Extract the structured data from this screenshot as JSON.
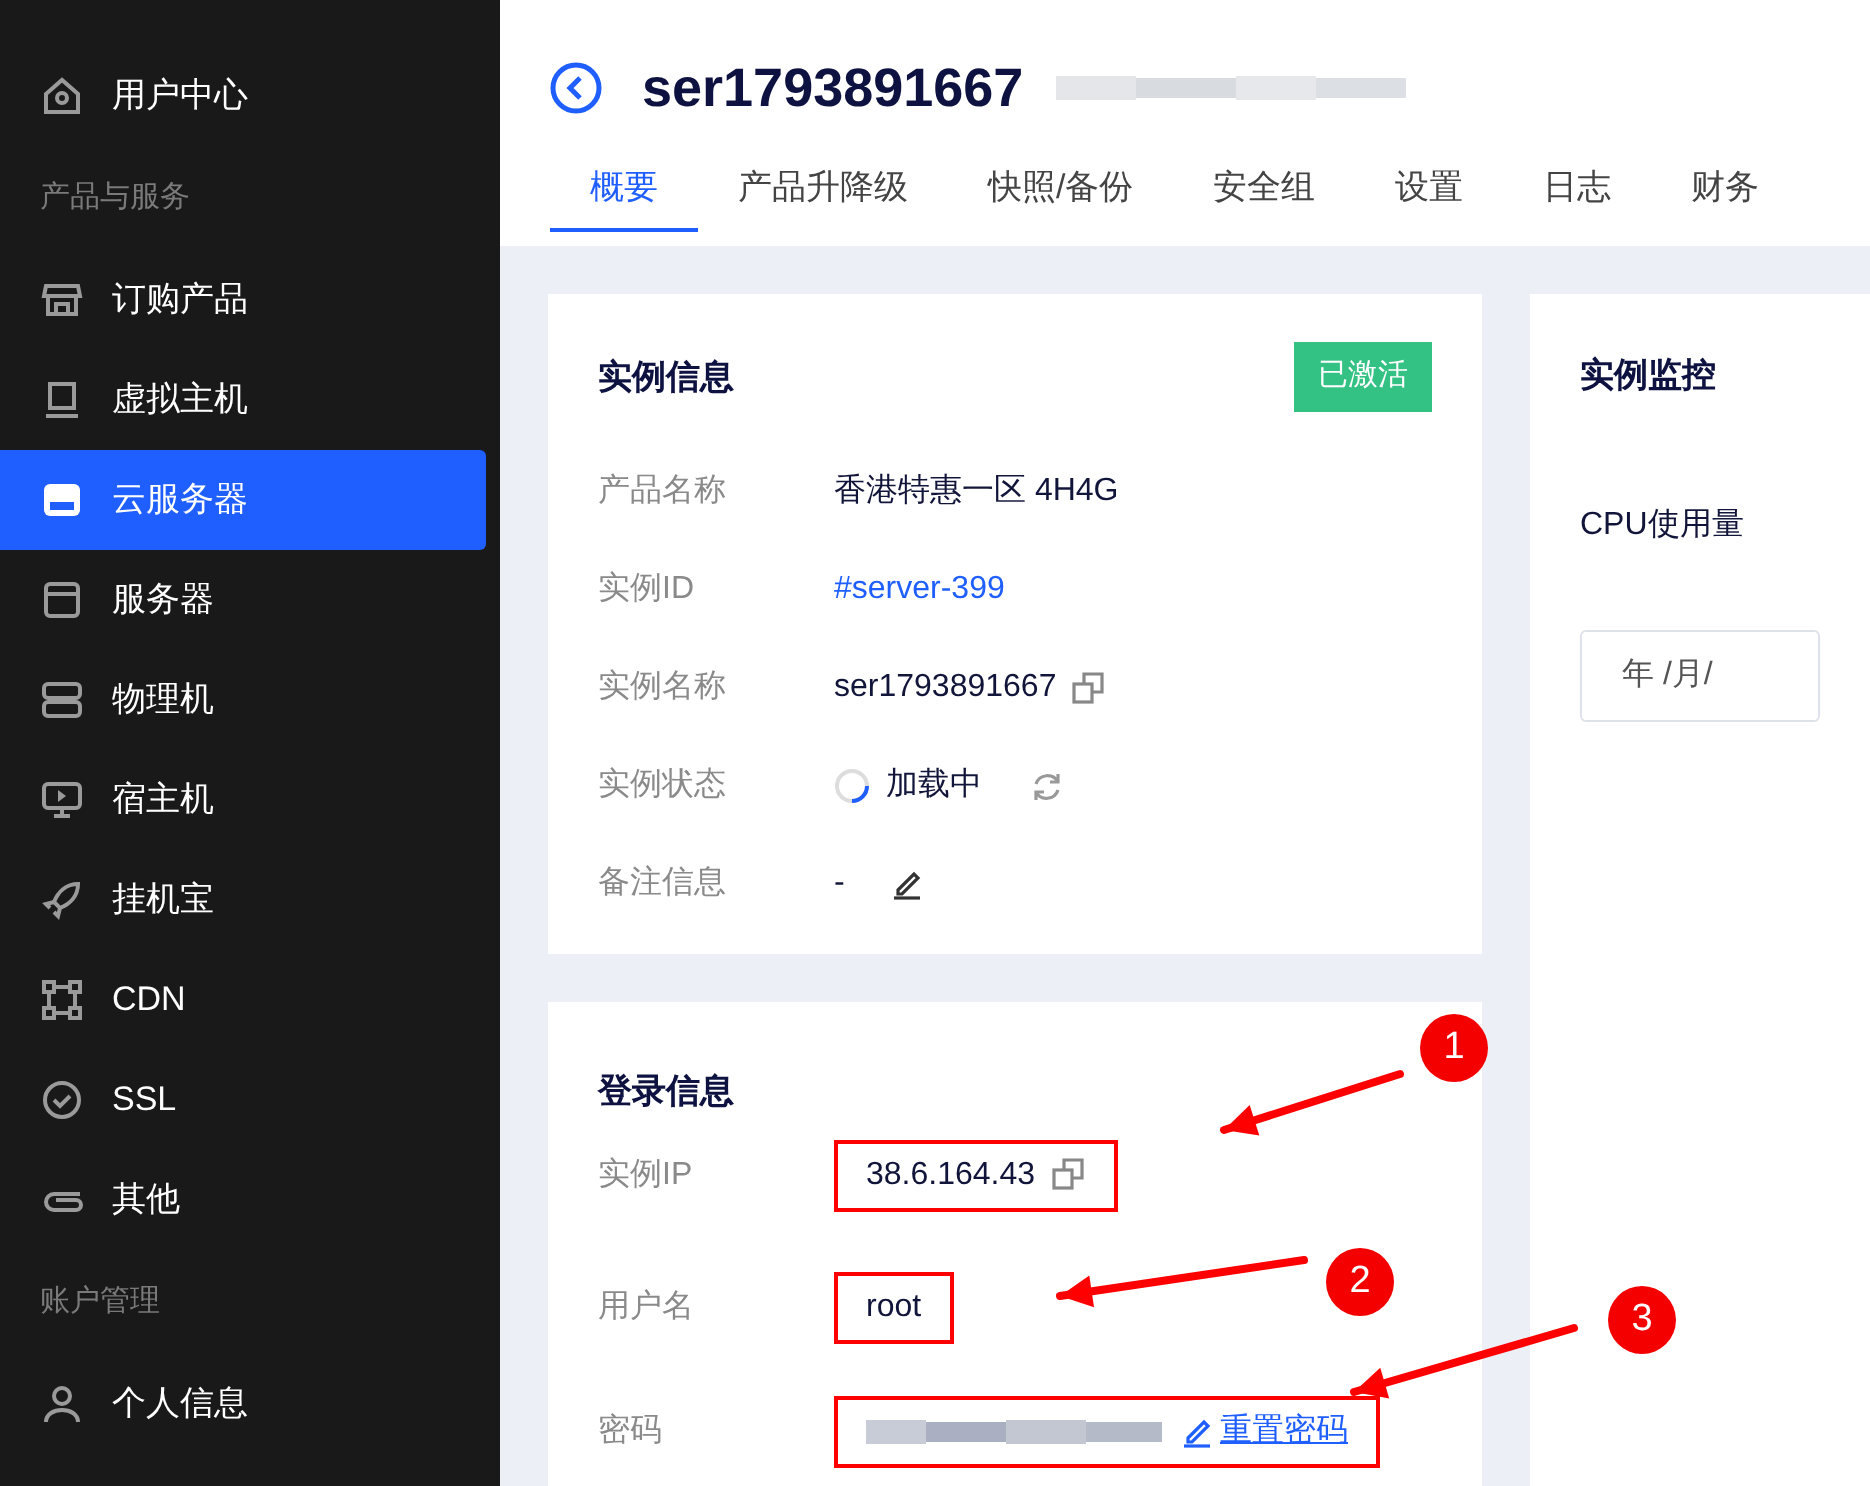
{
  "sidebar": {
    "items": [
      {
        "kind": "item",
        "label": "用户中心",
        "selected": false
      },
      {
        "kind": "section",
        "label": "产品与服务"
      },
      {
        "kind": "item",
        "label": "订购产品",
        "selected": false
      },
      {
        "kind": "item",
        "label": "虚拟主机",
        "selected": false
      },
      {
        "kind": "item",
        "label": "云服务器",
        "selected": true
      },
      {
        "kind": "item",
        "label": "服务器",
        "selected": false
      },
      {
        "kind": "item",
        "label": "物理机",
        "selected": false
      },
      {
        "kind": "item",
        "label": "宿主机",
        "selected": false
      },
      {
        "kind": "item",
        "label": "挂机宝",
        "selected": false
      },
      {
        "kind": "item",
        "label": "CDN",
        "selected": false
      },
      {
        "kind": "item",
        "label": "SSL",
        "selected": false
      },
      {
        "kind": "item",
        "label": "其他",
        "selected": false
      },
      {
        "kind": "section",
        "label": "账户管理"
      },
      {
        "kind": "item",
        "label": "个人信息",
        "selected": false
      }
    ]
  },
  "header": {
    "title": "ser1793891667"
  },
  "tabs": [
    {
      "label": "概要",
      "selected": true
    },
    {
      "label": "产品升降级",
      "selected": false
    },
    {
      "label": "快照/备份",
      "selected": false
    },
    {
      "label": "安全组",
      "selected": false
    },
    {
      "label": "设置",
      "selected": false
    },
    {
      "label": "日志",
      "selected": false
    },
    {
      "label": "财务",
      "selected": false
    }
  ],
  "instance_info": {
    "title": "实例信息",
    "status_badge": "已激活",
    "rows": [
      {
        "kind": "plain",
        "label": "产品名称",
        "value": "香港特惠一区 4H4G"
      },
      {
        "kind": "link",
        "label": "实例ID",
        "value": "#server-399"
      },
      {
        "kind": "copyable",
        "label": "实例名称",
        "value": "ser1793891667"
      },
      {
        "kind": "loading",
        "label": "实例状态",
        "value": "加载中"
      },
      {
        "kind": "editable",
        "label": "备注信息",
        "value": "-"
      }
    ]
  },
  "login_info": {
    "title": "登录信息",
    "rows": [
      {
        "kind": "copyable",
        "label": "实例IP",
        "value": "38.6.164.43",
        "highlighted": true
      },
      {
        "kind": "plain",
        "label": "用户名",
        "value": "root",
        "highlighted": true
      },
      {
        "kind": "secret",
        "label": "密码",
        "action": "重置密码",
        "highlighted": true
      }
    ]
  },
  "annotations": [
    {
      "number": "1"
    },
    {
      "number": "2"
    },
    {
      "number": "3"
    }
  ],
  "monitor": {
    "title": "实例监控",
    "metric": "CPU使用量",
    "date_field": {
      "placeholder": "年 /月/"
    }
  }
}
